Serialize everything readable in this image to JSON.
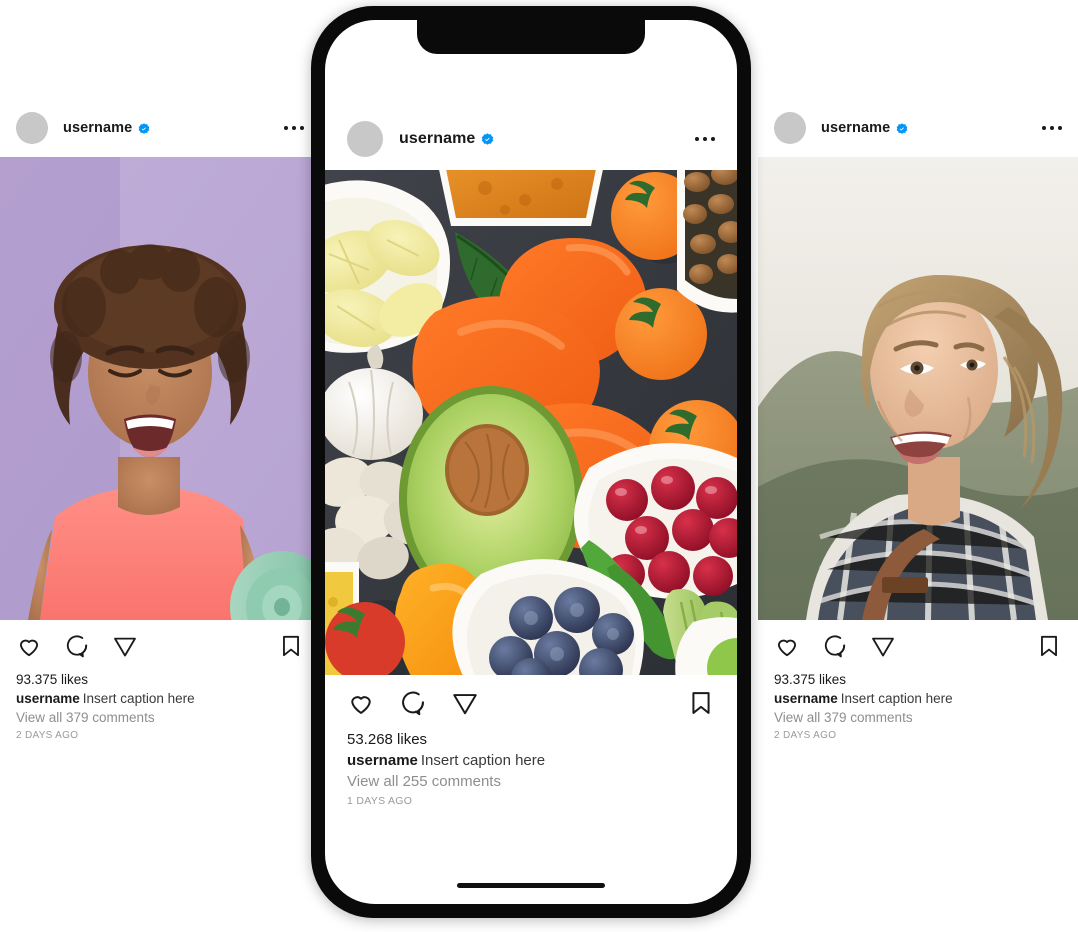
{
  "posts": {
    "left": {
      "username": "username",
      "verified": true,
      "likes": "93.375 likes",
      "caption_user": "username",
      "caption_text": "Insert caption here",
      "comments": "View all 379 comments",
      "timestamp": "2 DAYS AGO",
      "image_alt": "woman-in-pink-tank-top-with-yoga-mat-on-purple-background",
      "icons": [
        "heart-icon",
        "comment-icon",
        "share-icon",
        "bookmark-icon",
        "more-options-icon"
      ]
    },
    "center": {
      "username": "username",
      "verified": true,
      "likes": "53.268 likes",
      "caption_user": "username",
      "caption_text": "Insert caption here",
      "comments": "View all 255 comments",
      "timestamp": "1 DAYS AGO",
      "image_alt": "healthy-food-flatlay-lemons-peppers-avocado-berries-nuts",
      "icons": [
        "heart-icon",
        "comment-icon",
        "share-icon",
        "bookmark-icon",
        "more-options-icon"
      ]
    },
    "right": {
      "username": "username",
      "verified": true,
      "likes": "93.375 likes",
      "caption_user": "username",
      "caption_text": "Insert caption here",
      "comments": "View all 379 comments",
      "timestamp": "2 DAYS AGO",
      "image_alt": "smiling-woman-hiking-outdoors-with-backpack",
      "icons": [
        "heart-icon",
        "comment-icon",
        "share-icon",
        "bookmark-icon",
        "more-options-icon"
      ]
    }
  },
  "colors": {
    "verified_blue": "#0095f6",
    "text_primary": "#1a1a1a",
    "text_muted": "#8e8e8e",
    "avatar_grey": "#c8c8c8",
    "phone_frame": "#0a0a0a",
    "page_background": "#ffffff"
  },
  "device": {
    "name": "smartphone-mockup",
    "has_notch": true,
    "has_home_indicator": true
  }
}
